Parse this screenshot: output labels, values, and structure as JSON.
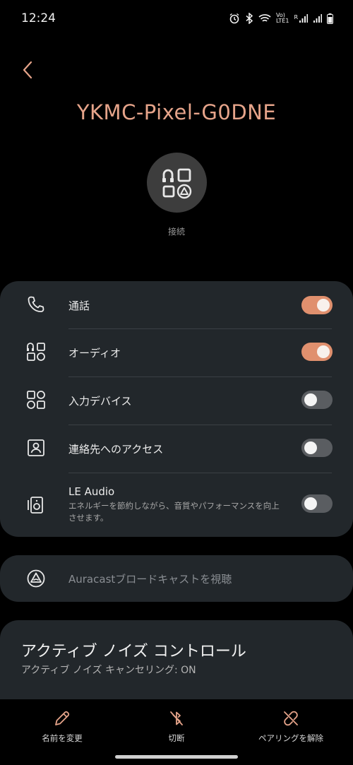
{
  "status_bar": {
    "time": "12:24",
    "lte_label": "LTE1",
    "volte_label": "Vo)",
    "roaming_label": "R",
    "icons": [
      "alarm-icon",
      "bluetooth-icon",
      "wifi-icon",
      "volte-icon",
      "signal-icon",
      "battery-icon"
    ]
  },
  "header": {
    "back_icon": "chevron-left-icon",
    "device_name": "YKMC-Pixel-G0DNE",
    "device_icon": "device-audio-icon",
    "connection_status": "接続"
  },
  "profiles": [
    {
      "icon": "phone-icon",
      "label": "通話",
      "subtitle": "",
      "enabled": true
    },
    {
      "icon": "audio-icon",
      "label": "オーディオ",
      "subtitle": "",
      "enabled": true
    },
    {
      "icon": "input-device-icon",
      "label": "入力デバイス",
      "subtitle": "",
      "enabled": false
    },
    {
      "icon": "contact-icon",
      "label": "連絡先へのアクセス",
      "subtitle": "",
      "enabled": false
    },
    {
      "icon": "le-audio-icon",
      "label": "LE Audio",
      "subtitle": "エネルギーを節約しながら、音質やパフォーマンスを向上させます。",
      "enabled": false
    }
  ],
  "auracast": {
    "icon": "auracast-icon",
    "label": "Auracastブロードキャストを視聴"
  },
  "anc": {
    "title": "アクティブ ノイズ コントロール",
    "subtitle": "アクティブ ノイズ キャンセリング: ON"
  },
  "bottom_actions": {
    "rename": {
      "icon": "pencil-icon",
      "label": "名前を変更"
    },
    "disconnect": {
      "icon": "bluetooth-off-icon",
      "label": "切断"
    },
    "unpair": {
      "icon": "unlink-icon",
      "label": "ペアリングを解除"
    }
  },
  "colors": {
    "accent": "#e0906e",
    "title": "#e6a48a",
    "card": "#22272b",
    "background": "#000000"
  }
}
